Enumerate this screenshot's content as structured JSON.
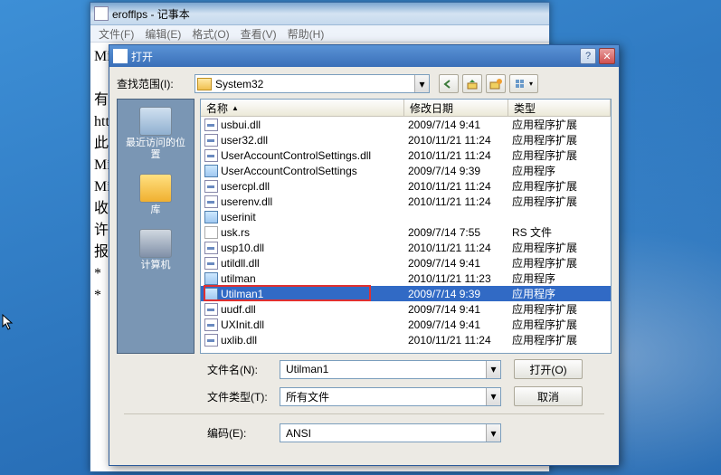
{
  "notepad": {
    "title": "erofflps - 记事本",
    "menu": [
      "文件(F)",
      "编辑(E)",
      "格式(O)",
      "查看(V)",
      "帮助(H)"
    ],
    "lines": [
      "Mic",
      "",
      "有关",
      "htt",
      "此外",
      "Mic",
      "Mic",
      "收到",
      "许多",
      "报告",
      "    *",
      "    *"
    ]
  },
  "dialog": {
    "title": "打开",
    "look_in_label": "查找范围(I):",
    "look_in_value": "System32",
    "headers": {
      "name": "名称",
      "date": "修改日期",
      "type": "类型"
    },
    "files": [
      {
        "icon": "dll",
        "name": "usbui.dll",
        "date": "2009/7/14 9:41",
        "type": "应用程序扩展"
      },
      {
        "icon": "dll",
        "name": "user32.dll",
        "date": "2010/11/21 11:24",
        "type": "应用程序扩展"
      },
      {
        "icon": "dll",
        "name": "UserAccountControlSettings.dll",
        "date": "2010/11/21 11:24",
        "type": "应用程序扩展"
      },
      {
        "icon": "exe",
        "name": "UserAccountControlSettings",
        "date": "2009/7/14 9:39",
        "type": "应用程序"
      },
      {
        "icon": "dll",
        "name": "usercpl.dll",
        "date": "2010/11/21 11:24",
        "type": "应用程序扩展"
      },
      {
        "icon": "dll",
        "name": "userenv.dll",
        "date": "2010/11/21 11:24",
        "type": "应用程序扩展"
      },
      {
        "icon": "exe",
        "name": "userinit",
        "date": "",
        "type": ""
      },
      {
        "icon": "rs",
        "name": "usk.rs",
        "date": "2009/7/14 7:55",
        "type": "RS 文件"
      },
      {
        "icon": "dll",
        "name": "usp10.dll",
        "date": "2010/11/21 11:24",
        "type": "应用程序扩展"
      },
      {
        "icon": "dll",
        "name": "utildll.dll",
        "date": "2009/7/14 9:41",
        "type": "应用程序扩展"
      },
      {
        "icon": "exe",
        "name": "utilman",
        "date": "2010/11/21 11:23",
        "type": "应用程序"
      },
      {
        "icon": "exe",
        "name": "Utilman1",
        "date": "2009/7/14 9:39",
        "type": "应用程序",
        "selected": true
      },
      {
        "icon": "dll",
        "name": "uudf.dll",
        "date": "2009/7/14 9:41",
        "type": "应用程序扩展"
      },
      {
        "icon": "dll",
        "name": "UXInit.dll",
        "date": "2009/7/14 9:41",
        "type": "应用程序扩展"
      },
      {
        "icon": "dll",
        "name": "uxlib.dll",
        "date": "2010/11/21 11:24",
        "type": "应用程序扩展"
      }
    ],
    "places": [
      {
        "key": "recent",
        "label": "最近访问的位\n置"
      },
      {
        "key": "lib",
        "label": "库"
      },
      {
        "key": "pc",
        "label": "计算机"
      }
    ],
    "filename_label": "文件名(N):",
    "filename_value": "Utilman1",
    "filetype_label": "文件类型(T):",
    "filetype_value": "所有文件",
    "encoding_label": "编码(E):",
    "encoding_value": "ANSI",
    "open_btn": "打开(O)",
    "cancel_btn": "取消",
    "highlight_index": 11
  }
}
